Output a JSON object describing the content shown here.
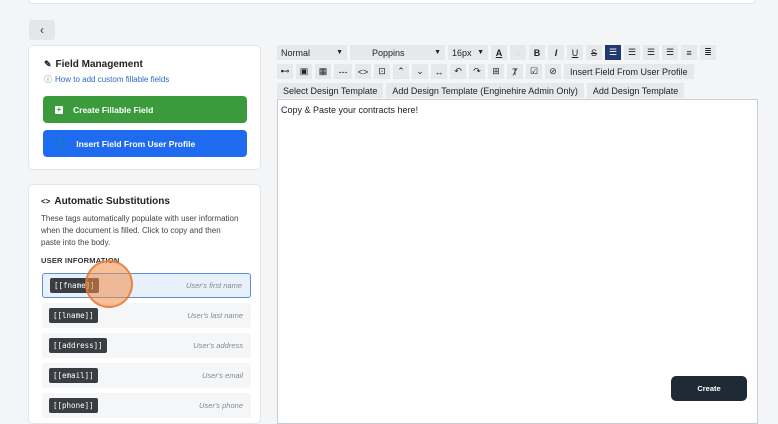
{
  "nav": {
    "back_icon": "chevron-left-icon",
    "back_glyph": "‹"
  },
  "field_management": {
    "title": "Field Management",
    "title_icon": "pencil-icon",
    "help_link": "How to add custom fillable fields",
    "help_icon": "help-circle-icon",
    "create_button": "Create Fillable Field",
    "create_icon": "plus-square-icon",
    "insert_button": "Insert Field From User Profile",
    "insert_icon": "user-icon"
  },
  "substitutions": {
    "title": "Automatic Substitutions",
    "title_icon": "code-icon",
    "description": "These tags automatically populate with user information when the document is filled. Click to copy and then paste into the body.",
    "section_label": "USER INFORMATION",
    "tags": [
      {
        "code": "[[fname]]",
        "hint": "User's first name"
      },
      {
        "code": "[[lname]]",
        "hint": "User's last name"
      },
      {
        "code": "[[address]]",
        "hint": "User's address"
      },
      {
        "code": "[[email]]",
        "hint": "User's email"
      },
      {
        "code": "[[phone]]",
        "hint": "User's phone"
      }
    ]
  },
  "toolbar": {
    "block_format": "Normal",
    "font_family": "Poppins",
    "font_size": "16px",
    "insert_field_label": "Insert Field From User Profile",
    "select_template_label": "Select Design Template",
    "add_template_admin_label": "Add Design Template (Enginehire Admin Only)",
    "add_template_label": "Add Design Template",
    "icons_row1": [
      {
        "name": "font-color-icon",
        "glyph": "A"
      },
      {
        "name": "highlight-icon",
        "glyph": "☐"
      },
      {
        "name": "bold-icon",
        "glyph": "B"
      },
      {
        "name": "italic-icon",
        "glyph": "I"
      },
      {
        "name": "underline-icon",
        "glyph": "U"
      },
      {
        "name": "strikethrough-icon",
        "glyph": "S"
      },
      {
        "name": "align-left-icon",
        "glyph": "☰",
        "active": true
      },
      {
        "name": "align-center-icon",
        "glyph": "☰"
      },
      {
        "name": "align-right-icon",
        "glyph": "☰"
      },
      {
        "name": "align-justify-icon",
        "glyph": "☰"
      },
      {
        "name": "bullet-list-icon",
        "glyph": "≡"
      },
      {
        "name": "numbered-list-icon",
        "glyph": "≣"
      }
    ],
    "icons_row2": [
      {
        "name": "link-icon",
        "glyph": "⛓"
      },
      {
        "name": "image-icon",
        "glyph": "▣"
      },
      {
        "name": "table-icon",
        "glyph": "▦"
      },
      {
        "name": "horizontal-rule-icon",
        "glyph": "---"
      },
      {
        "name": "code-view-icon",
        "glyph": "<>"
      },
      {
        "name": "fullscreen-icon",
        "glyph": "⊡"
      },
      {
        "name": "superscript-icon",
        "glyph": "⌃"
      },
      {
        "name": "subscript-icon",
        "glyph": "⌄"
      },
      {
        "name": "line-height-icon",
        "glyph": "↔"
      },
      {
        "name": "undo-icon",
        "glyph": "↶"
      },
      {
        "name": "redo-icon",
        "glyph": "↷"
      },
      {
        "name": "select-all-icon",
        "glyph": "⊞"
      },
      {
        "name": "clear-format-icon",
        "glyph": "Ⱦ"
      },
      {
        "name": "checklist-icon",
        "glyph": "☑"
      },
      {
        "name": "remove-icon",
        "glyph": "⊘"
      }
    ]
  },
  "editor": {
    "body_text": "Copy & Paste your contracts here!"
  },
  "actions": {
    "create_label": "Create"
  }
}
